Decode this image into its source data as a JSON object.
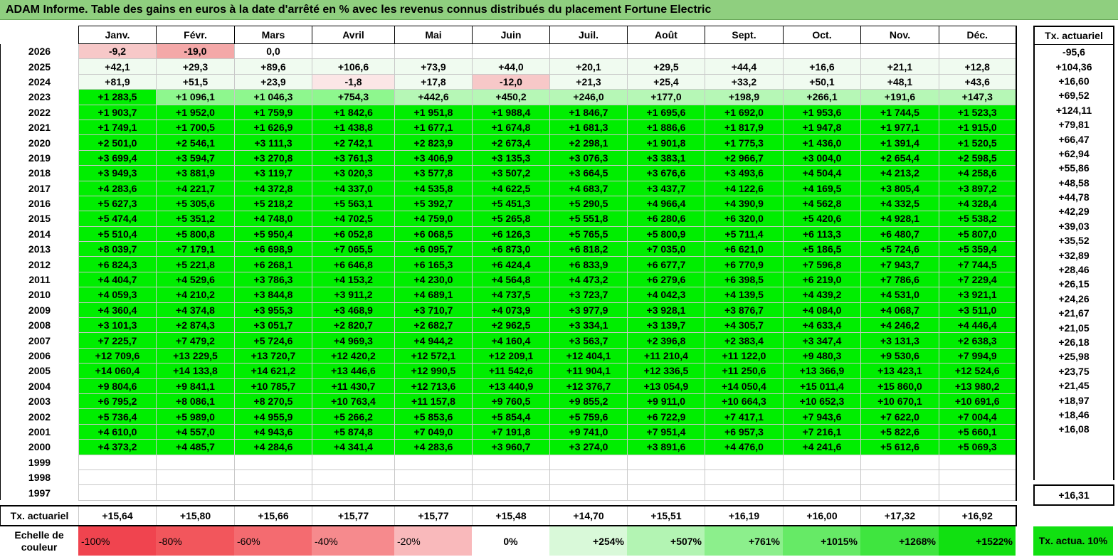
{
  "title": "ADAM Informe. Table des gains en euros à la date d'arrêté en % avec les revenus connus distribués du placement Fortune Electric",
  "months": [
    "Janv.",
    "Févr.",
    "Mars",
    "Avril",
    "Mai",
    "Juin",
    "Juil.",
    "Août",
    "Sept.",
    "Oct.",
    "Nov.",
    "Déc."
  ],
  "side_header": "Tx. actuariel",
  "footer_label": "Tx. actuariel",
  "colors": {
    "strong_green": "#00ee00",
    "light_green1": "#8ef78e",
    "light_green2": "#b6f7b6",
    "pale_green": "#f0fbf0",
    "pale_red": "#fbe6e6",
    "light_red": "#f7c8c8",
    "red": "#f4a8a8"
  },
  "rows": [
    {
      "year": "2026",
      "values": [
        "-9,2",
        "-19,0",
        "0,0",
        "",
        "",
        "",
        "",
        "",
        "",
        "",
        "",
        ""
      ],
      "rate": "-95,6",
      "colors": [
        "light_red",
        "red",
        "",
        "",
        "",
        "",
        "",
        "",
        "",
        "",
        "",
        ""
      ]
    },
    {
      "year": "2025",
      "values": [
        "+42,1",
        "+29,3",
        "+89,6",
        "+106,6",
        "+73,9",
        "+44,0",
        "+20,1",
        "+29,5",
        "+44,4",
        "+16,6",
        "+21,1",
        "+12,8"
      ],
      "rate": "+104,36",
      "colors": [
        "pale_green",
        "pale_green",
        "pale_green",
        "pale_green",
        "pale_green",
        "pale_green",
        "pale_green",
        "pale_green",
        "pale_green",
        "pale_green",
        "pale_green",
        "pale_green"
      ]
    },
    {
      "year": "2024",
      "values": [
        "+81,9",
        "+51,5",
        "+23,9",
        "-1,8",
        "+17,8",
        "-12,0",
        "+21,3",
        "+25,4",
        "+33,2",
        "+50,1",
        "+48,1",
        "+43,6"
      ],
      "rate": "+16,60",
      "colors": [
        "pale_green",
        "pale_green",
        "pale_green",
        "pale_red",
        "pale_green",
        "light_red",
        "pale_green",
        "pale_green",
        "pale_green",
        "pale_green",
        "pale_green",
        "pale_green"
      ]
    },
    {
      "year": "2023",
      "values": [
        "+1 283,5",
        "+1 096,1",
        "+1 046,3",
        "+754,3",
        "+442,6",
        "+450,2",
        "+246,0",
        "+177,0",
        "+198,9",
        "+266,1",
        "+191,6",
        "+147,3"
      ],
      "rate": "+69,52",
      "colors": [
        "strong_green",
        "light_green1",
        "light_green1",
        "light_green1",
        "light_green2",
        "light_green2",
        "light_green2",
        "light_green2",
        "light_green2",
        "light_green2",
        "light_green2",
        "light_green2"
      ]
    },
    {
      "year": "2022",
      "values": [
        "+1 903,7",
        "+1 952,0",
        "+1 759,9",
        "+1 842,6",
        "+1 951,8",
        "+1 988,4",
        "+1 846,7",
        "+1 695,6",
        "+1 692,0",
        "+1 953,6",
        "+1 744,5",
        "+1 523,3"
      ],
      "rate": "+124,11"
    },
    {
      "year": "2021",
      "values": [
        "+1 749,1",
        "+1 700,5",
        "+1 626,9",
        "+1 438,8",
        "+1 677,1",
        "+1 674,8",
        "+1 681,3",
        "+1 886,6",
        "+1 817,9",
        "+1 947,8",
        "+1 977,1",
        "+1 915,0"
      ],
      "rate": "+79,81"
    },
    {
      "year": "2020",
      "values": [
        "+2 501,0",
        "+2 546,1",
        "+3 111,3",
        "+2 742,1",
        "+2 823,9",
        "+2 673,4",
        "+2 298,1",
        "+1 901,8",
        "+1 775,3",
        "+1 436,0",
        "+1 391,4",
        "+1 520,5"
      ],
      "rate": "+66,47"
    },
    {
      "year": "2019",
      "values": [
        "+3 699,4",
        "+3 594,7",
        "+3 270,8",
        "+3 761,3",
        "+3 406,9",
        "+3 135,3",
        "+3 076,3",
        "+3 383,1",
        "+2 966,7",
        "+3 004,0",
        "+2 654,4",
        "+2 598,5"
      ],
      "rate": "+62,94"
    },
    {
      "year": "2018",
      "values": [
        "+3 949,3",
        "+3 881,9",
        "+3 119,7",
        "+3 020,3",
        "+3 577,8",
        "+3 507,2",
        "+3 664,5",
        "+3 676,6",
        "+3 493,6",
        "+4 504,4",
        "+4 213,2",
        "+4 258,6"
      ],
      "rate": "+55,86"
    },
    {
      "year": "2017",
      "values": [
        "+4 283,6",
        "+4 221,7",
        "+4 372,8",
        "+4 337,0",
        "+4 535,8",
        "+4 622,5",
        "+4 683,7",
        "+3 437,7",
        "+4 122,6",
        "+4 169,5",
        "+3 805,4",
        "+3 897,2"
      ],
      "rate": "+48,58"
    },
    {
      "year": "2016",
      "values": [
        "+5 627,3",
        "+5 305,6",
        "+5 218,2",
        "+5 563,1",
        "+5 392,7",
        "+5 451,3",
        "+5 290,5",
        "+4 966,4",
        "+4 390,9",
        "+4 562,8",
        "+4 332,5",
        "+4 328,4"
      ],
      "rate": "+44,78"
    },
    {
      "year": "2015",
      "values": [
        "+5 474,4",
        "+5 351,2",
        "+4 748,0",
        "+4 702,5",
        "+4 759,0",
        "+5 265,8",
        "+5 551,8",
        "+6 280,6",
        "+6 320,0",
        "+5 420,6",
        "+4 928,1",
        "+5 538,2"
      ],
      "rate": "+42,29"
    },
    {
      "year": "2014",
      "values": [
        "+5 510,4",
        "+5 800,8",
        "+5 950,4",
        "+6 052,8",
        "+6 068,5",
        "+6 126,3",
        "+5 765,5",
        "+5 800,9",
        "+5 711,4",
        "+6 113,3",
        "+6 480,7",
        "+5 807,0"
      ],
      "rate": "+39,03"
    },
    {
      "year": "2013",
      "values": [
        "+8 039,7",
        "+7 179,1",
        "+6 698,9",
        "+7 065,5",
        "+6 095,7",
        "+6 873,0",
        "+6 818,2",
        "+7 035,0",
        "+6 621,0",
        "+5 186,5",
        "+5 724,6",
        "+5 359,4"
      ],
      "rate": "+35,52"
    },
    {
      "year": "2012",
      "values": [
        "+6 824,3",
        "+5 221,8",
        "+6 268,1",
        "+6 646,8",
        "+6 165,3",
        "+6 424,4",
        "+6 833,9",
        "+6 677,7",
        "+6 770,9",
        "+7 596,8",
        "+7 943,7",
        "+7 744,5"
      ],
      "rate": "+32,89"
    },
    {
      "year": "2011",
      "values": [
        "+4 404,7",
        "+4 529,6",
        "+3 786,3",
        "+4 153,2",
        "+4 230,0",
        "+4 564,8",
        "+4 473,2",
        "+6 279,6",
        "+6 398,5",
        "+6 219,0",
        "+7 786,6",
        "+7 229,4"
      ],
      "rate": "+28,46"
    },
    {
      "year": "2010",
      "values": [
        "+4 059,3",
        "+4 210,2",
        "+3 844,8",
        "+3 911,2",
        "+4 689,1",
        "+4 737,5",
        "+3 723,7",
        "+4 042,3",
        "+4 139,5",
        "+4 439,2",
        "+4 531,0",
        "+3 921,1"
      ],
      "rate": "+26,15"
    },
    {
      "year": "2009",
      "values": [
        "+4 360,4",
        "+4 374,8",
        "+3 955,3",
        "+3 468,9",
        "+3 710,7",
        "+4 073,9",
        "+3 977,9",
        "+3 928,1",
        "+3 876,7",
        "+4 084,0",
        "+4 068,7",
        "+3 511,0"
      ],
      "rate": "+24,26"
    },
    {
      "year": "2008",
      "values": [
        "+3 101,3",
        "+2 874,3",
        "+3 051,7",
        "+2 820,7",
        "+2 682,7",
        "+2 962,5",
        "+3 334,1",
        "+3 139,7",
        "+4 305,7",
        "+4 633,4",
        "+4 246,2",
        "+4 446,4"
      ],
      "rate": "+21,67"
    },
    {
      "year": "2007",
      "values": [
        "+7 225,7",
        "+7 479,2",
        "+5 724,6",
        "+4 969,3",
        "+4 944,2",
        "+4 160,4",
        "+3 563,7",
        "+2 396,8",
        "+2 383,4",
        "+3 347,4",
        "+3 131,3",
        "+2 638,3"
      ],
      "rate": "+21,05"
    },
    {
      "year": "2006",
      "values": [
        "+12 709,6",
        "+13 229,5",
        "+13 720,7",
        "+12 420,2",
        "+12 572,1",
        "+12 209,1",
        "+12 404,1",
        "+11 210,4",
        "+11 122,0",
        "+9 480,3",
        "+9 530,6",
        "+7 994,9"
      ],
      "rate": "+26,18"
    },
    {
      "year": "2005",
      "values": [
        "+14 060,4",
        "+14 133,8",
        "+14 621,2",
        "+13 446,6",
        "+12 990,5",
        "+11 542,6",
        "+11 904,1",
        "+12 336,5",
        "+11 250,6",
        "+13 366,9",
        "+13 423,1",
        "+12 524,6"
      ],
      "rate": "+25,98"
    },
    {
      "year": "2004",
      "values": [
        "+9 804,6",
        "+9 841,1",
        "+10 785,7",
        "+11 430,7",
        "+12 713,6",
        "+13 440,9",
        "+12 376,7",
        "+13 054,9",
        "+14 050,4",
        "+15 011,4",
        "+15 860,0",
        "+13 980,2"
      ],
      "rate": "+23,75"
    },
    {
      "year": "2003",
      "values": [
        "+6 795,2",
        "+8 086,1",
        "+8 270,5",
        "+10 763,4",
        "+11 157,8",
        "+9 760,5",
        "+9 855,2",
        "+9 911,0",
        "+10 664,3",
        "+10 652,3",
        "+10 670,1",
        "+10 691,6"
      ],
      "rate": "+21,45"
    },
    {
      "year": "2002",
      "values": [
        "+5 736,4",
        "+5 989,0",
        "+4 955,9",
        "+5 266,2",
        "+5 853,6",
        "+5 854,4",
        "+5 759,6",
        "+6 722,9",
        "+7 417,1",
        "+7 943,6",
        "+7 622,0",
        "+7 004,4"
      ],
      "rate": "+18,97"
    },
    {
      "year": "2001",
      "values": [
        "+4 610,0",
        "+4 557,0",
        "+4 943,6",
        "+5 874,8",
        "+7 049,0",
        "+7 191,8",
        "+9 741,0",
        "+7 951,4",
        "+6 957,3",
        "+7 216,1",
        "+5 822,6",
        "+5 660,1"
      ],
      "rate": "+18,46"
    },
    {
      "year": "2000",
      "values": [
        "+4 373,2",
        "+4 485,7",
        "+4 284,6",
        "+4 341,4",
        "+4 283,6",
        "+3 960,7",
        "+3 274,0",
        "+3 891,6",
        "+4 476,0",
        "+4 241,6",
        "+5 612,6",
        "+5 069,3"
      ],
      "rate": "+16,08"
    },
    {
      "year": "1999",
      "values": [
        "",
        "",
        "",
        "",
        "",
        "",
        "",
        "",
        "",
        "",
        "",
        ""
      ],
      "rate": "",
      "colors": [
        "white",
        "white",
        "white",
        "white",
        "white",
        "white",
        "white",
        "white",
        "white",
        "white",
        "white",
        "white"
      ]
    },
    {
      "year": "1998",
      "values": [
        "",
        "",
        "",
        "",
        "",
        "",
        "",
        "",
        "",
        "",
        "",
        ""
      ],
      "rate": "",
      "colors": [
        "white",
        "white",
        "white",
        "white",
        "white",
        "white",
        "white",
        "white",
        "white",
        "white",
        "white",
        "white"
      ]
    },
    {
      "year": "1997",
      "values": [
        "",
        "",
        "",
        "",
        "",
        "",
        "",
        "",
        "",
        "",
        "",
        ""
      ],
      "rate": "",
      "colors": [
        "white",
        "white",
        "white",
        "white",
        "white",
        "white",
        "white",
        "white",
        "white",
        "white",
        "white",
        "white"
      ]
    }
  ],
  "footer_values": [
    "+15,64",
    "+15,80",
    "+15,66",
    "+15,77",
    "+15,77",
    "+15,48",
    "+14,70",
    "+15,51",
    "+16,19",
    "+16,00",
    "+17,32",
    "+16,92"
  ],
  "footer_rate": "+16,31",
  "scale": {
    "label": "Echelle de couleur",
    "items": [
      {
        "text": "-100%",
        "color": "#f0444f",
        "kind": "neg"
      },
      {
        "text": "-80%",
        "color": "#f2565c",
        "kind": "neg"
      },
      {
        "text": "-60%",
        "color": "#f46b70",
        "kind": "neg"
      },
      {
        "text": "-40%",
        "color": "#f68a8d",
        "kind": "neg"
      },
      {
        "text": "-20%",
        "color": "#f9b9bb",
        "kind": "neg"
      },
      {
        "text": "0%",
        "color": "#ffffff",
        "kind": "zero"
      },
      {
        "text": "+254%",
        "color": "#d9f9d9",
        "kind": "pos"
      },
      {
        "text": "+507%",
        "color": "#b3f4b3",
        "kind": "pos"
      },
      {
        "text": "+761%",
        "color": "#8cef8c",
        "kind": "pos"
      },
      {
        "text": "+1015%",
        "color": "#66ea66",
        "kind": "pos"
      },
      {
        "text": "+1268%",
        "color": "#3fe53f",
        "kind": "pos"
      },
      {
        "text": "+1522%",
        "color": "#11e011",
        "kind": "pos"
      }
    ],
    "side_label": "Tx. actua. 10%",
    "side_color": "#11e011"
  }
}
